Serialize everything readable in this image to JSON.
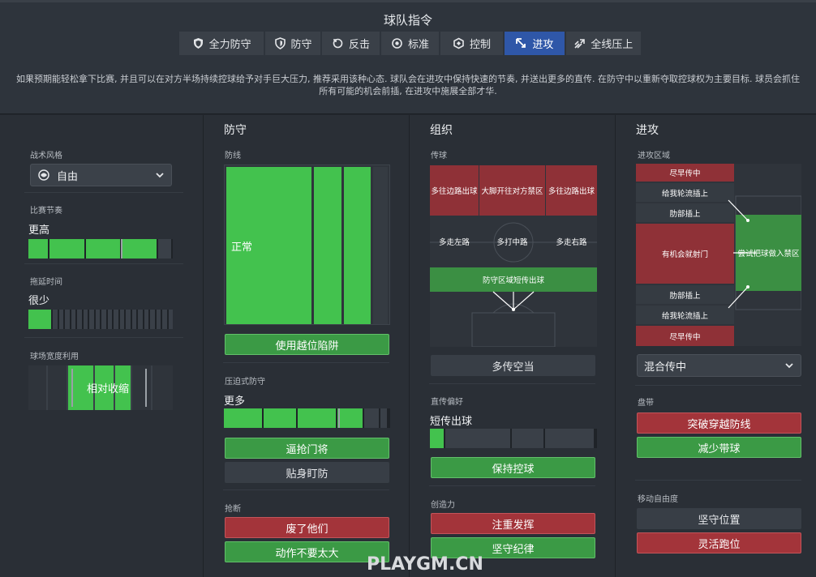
{
  "header": {
    "title": "球队指令",
    "mentalities": [
      {
        "label": "全力防守",
        "icon": "shield-double-icon",
        "active": false
      },
      {
        "label": "防守",
        "icon": "shield-icon",
        "active": false
      },
      {
        "label": "反击",
        "icon": "counter-arrow-icon",
        "active": false
      },
      {
        "label": "标准",
        "icon": "balance-icon",
        "active": false
      },
      {
        "label": "控制",
        "icon": "control-icon",
        "active": false
      },
      {
        "label": "进攻",
        "icon": "attack-arrow-icon",
        "active": true
      },
      {
        "label": "全线压上",
        "icon": "all-out-arrows-icon",
        "active": false
      }
    ],
    "description": "如果预期能轻松拿下比赛, 并且可以在对方半场持续控球给予对手巨大压力, 推荐采用该种心态. 球队会在进攻中保持快速的节奏, 并送出更多的直传. 在防守中以重新夺取控球权为主要目标. 球员会抓住所有可能的机会前插, 在进攻中施展全部才华."
  },
  "left": {
    "tactical_style_label": "战术风格",
    "tactical_style_value": "自由",
    "tempo_label": "比赛节奏",
    "tempo_value": "更高",
    "tempo_level": 0.8,
    "time_wasting_label": "拖延时间",
    "time_wasting_value": "很少",
    "time_wasting_level": 0.2,
    "width_label": "球场宽度利用",
    "width_value": "相对收缩"
  },
  "defence": {
    "title": "防守",
    "line_label": "防线",
    "line_value": "正常",
    "offside_trap": "使用越位陷阱",
    "press_label": "压迫式防守",
    "press_value": "更多",
    "press_level": 0.8,
    "close_down": "逼抢门将",
    "mark_tight": "贴身盯防",
    "tackling_label": "抢断",
    "get_stuck_in": "废了他们",
    "stay_on_feet": "动作不要太大"
  },
  "organisation": {
    "title": "组织",
    "passing_label": "传球",
    "cells_top": [
      "多往边路出球",
      "大脚开往对方禁区",
      "多往边路出球"
    ],
    "cells_mid": [
      "多走左路",
      "多打中路",
      "多走右路"
    ],
    "short_gk": "防守区域短传出球",
    "play_into_space": "多传空当",
    "directness_label": "直传偏好",
    "directness_value": "短传出球",
    "directness_level": 0.1,
    "retain_possession": "保持控球",
    "creativity_label": "创造力",
    "be_expressive": "注重发挥",
    "be_disciplined": "坚守纪律"
  },
  "attack": {
    "title": "进攻",
    "area_label": "进攻区域",
    "cross_early_top": "尽早传中",
    "overlap_top": "给我轮流插上",
    "underlap_top": "肋部插上",
    "shoot_on_sight": "有机会就射门",
    "work_into_box": "尝试把球做入禁区",
    "underlap_bottom": "肋部插上",
    "overlap_bottom": "给我轮流插上",
    "cross_early_bottom": "尽早传中",
    "crossing_style": "混合传中",
    "dribbling_label": "盘带",
    "run_at_defence": "突破穿越防线",
    "dribble_less": "减少带球",
    "freedom_label": "移动自由度",
    "hold_position": "坚守位置",
    "roam": "灵活跑位"
  },
  "watermark": "PLAYGM.CN",
  "colors": {
    "green": "#43c24e",
    "red": "#a3343a",
    "active_tab": "#2f57a8"
  }
}
